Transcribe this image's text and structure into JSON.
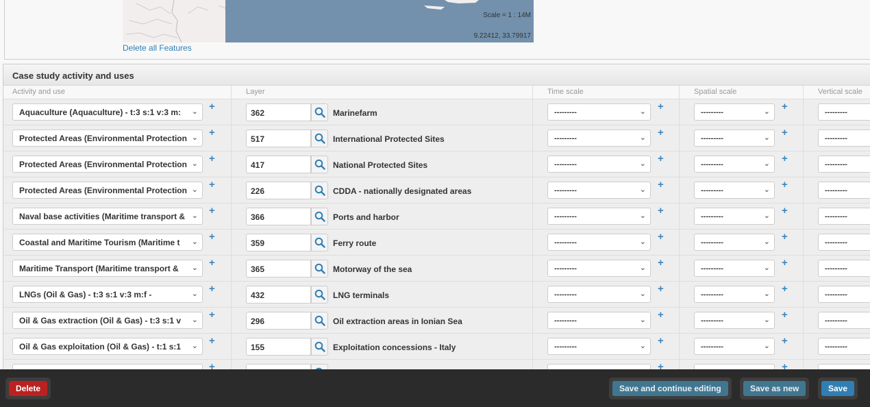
{
  "map": {
    "scale_label": "Scale = 1 : 14M",
    "coords": "9.22412, 33.79917",
    "delete_all_features": "Delete all Features"
  },
  "module": {
    "title": "Case study activity and uses",
    "columns": {
      "activity": "Activity and use",
      "layer": "Layer",
      "time": "Time scale",
      "spatial": "Spatial scale",
      "vertical": "Vertical scale"
    },
    "empty_option": "---------",
    "rows": [
      {
        "activity": "Aquaculture (Aquaculture) - t:3 s:1 v:3 m:",
        "layer_id": "362",
        "layer_name": "Marinefarm"
      },
      {
        "activity": "Protected Areas (Environmental Protection",
        "layer_id": "517",
        "layer_name": "International Protected Sites"
      },
      {
        "activity": "Protected Areas (Environmental Protection",
        "layer_id": "417",
        "layer_name": "National Protected Sites"
      },
      {
        "activity": "Protected Areas (Environmental Protection",
        "layer_id": "226",
        "layer_name": "CDDA - nationally designated areas"
      },
      {
        "activity": "Naval base activities (Maritime transport &",
        "layer_id": "366",
        "layer_name": "Ports and harbor"
      },
      {
        "activity": "Coastal and Maritime Tourism (Maritime t",
        "layer_id": "359",
        "layer_name": "Ferry route"
      },
      {
        "activity": "Maritime Transport (Maritime transport &",
        "layer_id": "365",
        "layer_name": "Motorway of the sea"
      },
      {
        "activity": "LNGs (Oil & Gas) - t:3 s:1 v:3 m:f -",
        "layer_id": "432",
        "layer_name": "LNG terminals"
      },
      {
        "activity": "Oil & Gas extraction (Oil & Gas) - t:3 s:1 v",
        "layer_id": "296",
        "layer_name": "Oil extraction areas in Ionian Sea"
      },
      {
        "activity": "Oil & Gas exploitation (Oil & Gas) - t:1 s:1",
        "layer_id": "155",
        "layer_name": "Exploitation concessions - Italy"
      },
      {
        "activity": "",
        "layer_id": "",
        "layer_name": ""
      }
    ]
  },
  "footer": {
    "delete": "Delete",
    "save_continue": "Save and continue editing",
    "save_as_new": "Save as new",
    "save": "Save"
  }
}
